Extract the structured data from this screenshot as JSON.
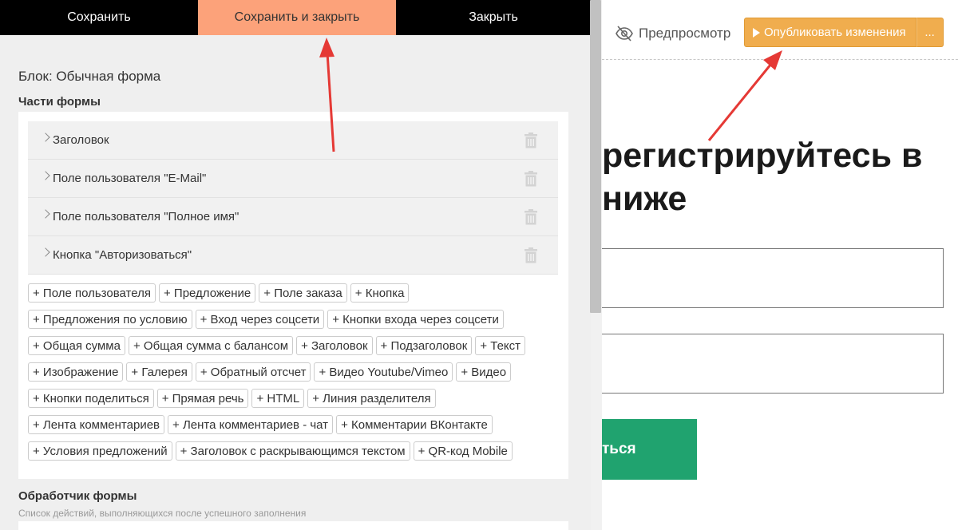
{
  "topbar": {
    "save_label": "Сохранить",
    "save_close_label": "Сохранить и закрыть",
    "close_label": "Закрыть"
  },
  "block_title": "Блок: Обычная форма",
  "parts_section": {
    "title": "Части формы",
    "items": [
      {
        "label": "Заголовок"
      },
      {
        "label": "Поле пользователя \"E-Mail\""
      },
      {
        "label": "Поле пользователя \"Полное имя\""
      },
      {
        "label": "Кнопка \"Авторизоваться\""
      }
    ]
  },
  "add_tags": [
    [
      "+ Поле пользователя",
      "+ Предложение",
      "+ Поле заказа",
      "+ Кнопка"
    ],
    [
      "+ Предложения по условию",
      "+ Вход через соцсети",
      "+ Кнопки входа через соцсети"
    ],
    [
      "+ Общая сумма",
      "+ Общая сумма с балансом",
      "+ Заголовок",
      "+ Подзаголовок",
      "+ Текст"
    ],
    [
      "+ Изображение",
      "+ Галерея",
      "+ Обратный отсчет",
      "+ Видео Youtube/Vimeo",
      "+ Видео"
    ],
    [
      "+ Кнопки поделиться",
      "+ Прямая речь",
      "+ HTML",
      "+ Линия разделителя"
    ],
    [
      "+ Лента комментариев",
      "+ Лента комментариев - чат",
      "+ Комментарии ВКонтакте"
    ],
    [
      "+ Условия предложений",
      "+ Заголовок с раскрывающимся текстом",
      "+ QR-код Mobile"
    ]
  ],
  "handler_section": {
    "title": "Обработчик формы",
    "subtitle": "Список действий, выполняющихся после успешного заполнения"
  },
  "preview_toolbar": {
    "preview_label": "Предпросмотр",
    "publish_label": "Опубликовать изменения",
    "more_label": "..."
  },
  "preview_page": {
    "heading_line1": "регистрируйтесь в",
    "heading_line2": "ниже",
    "button_text": "ться"
  },
  "colors": {
    "save_close_bg": "#fca27a",
    "publish_bg": "#f0ad4e",
    "green_button": "#20a36f",
    "annotation_arrow": "#e53935"
  }
}
